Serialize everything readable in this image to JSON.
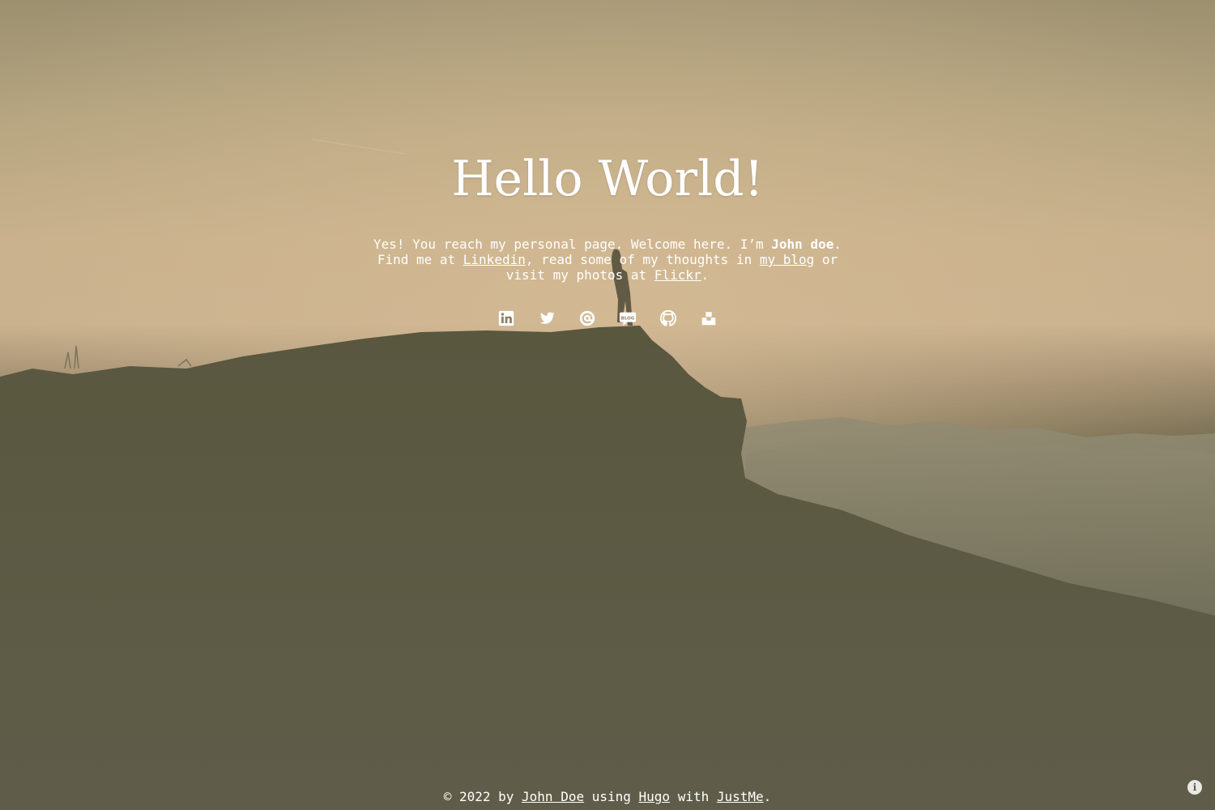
{
  "hero": {
    "title": "Hello World!",
    "intro_prefix": "Yes! You reach my personal page. Welcome here. I’m ",
    "intro_name": "John doe",
    "intro_find": ". Find me at ",
    "link_linkedin": "Linkedin",
    "intro_read": ", read some of my thoughts in ",
    "link_blog": "my blog",
    "intro_visit": " or visit my photos at ",
    "link_flickr": "Flickr",
    "intro_end": "."
  },
  "socials": [
    {
      "name": "linkedin-icon"
    },
    {
      "name": "twitter-icon"
    },
    {
      "name": "email-icon"
    },
    {
      "name": "blog-icon",
      "badge": "BLOG"
    },
    {
      "name": "github-icon"
    },
    {
      "name": "unsplash-icon"
    }
  ],
  "footer": {
    "prefix": "© 2022 by ",
    "author": "John Doe",
    "using": " using ",
    "hugo": "Hugo",
    "with": " with ",
    "theme": "JustMe",
    "end": "."
  },
  "info_button": {
    "icon": "info-icon",
    "glyph": "i"
  },
  "colors": {
    "text": "#ffffff",
    "sky_top": "#9c9070",
    "sky_glow": "#c9b18e",
    "hill": "#5f5d46"
  }
}
